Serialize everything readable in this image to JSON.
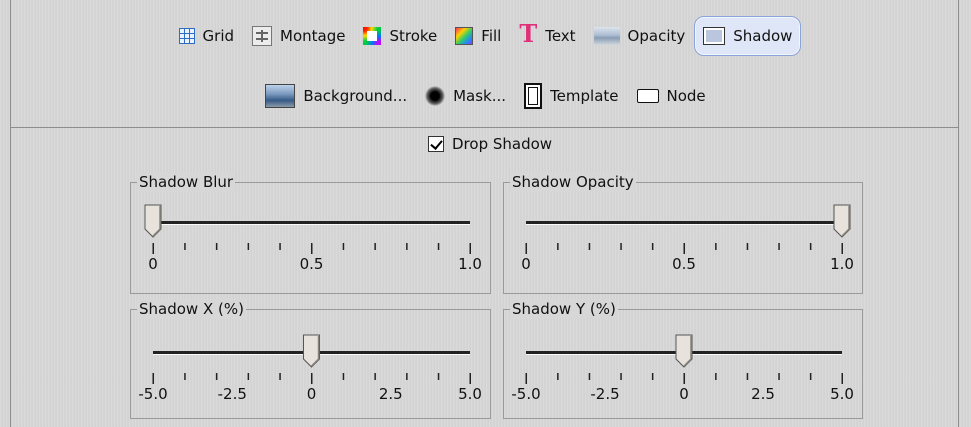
{
  "toolbar": {
    "row1": [
      {
        "label": "Grid",
        "icon": "grid-icon"
      },
      {
        "label": "Montage",
        "icon": "montage-icon"
      },
      {
        "label": "Stroke",
        "icon": "stroke-icon"
      },
      {
        "label": "Fill",
        "icon": "fill-icon"
      },
      {
        "label": "Text",
        "icon": "text-icon"
      },
      {
        "label": "Opacity",
        "icon": "opacity-icon"
      },
      {
        "label": "Shadow",
        "icon": "shadow-icon",
        "active": true
      }
    ],
    "row2": [
      {
        "label": "Background...",
        "icon": "background-icon"
      },
      {
        "label": "Mask...",
        "icon": "mask-icon"
      },
      {
        "label": "Template",
        "icon": "template-icon"
      },
      {
        "label": "Node",
        "icon": "node-icon"
      }
    ]
  },
  "drop_shadow": {
    "label": "Drop Shadow",
    "checked": true
  },
  "sliders": {
    "blur": {
      "title": "Shadow Blur",
      "min": 0,
      "max": 1.0,
      "value": 0,
      "labels": [
        "0",
        "0.5",
        "1.0"
      ],
      "ticks": 11
    },
    "opacity": {
      "title": "Shadow Opacity",
      "min": 0,
      "max": 1.0,
      "value": 1.0,
      "labels": [
        "0",
        "0.5",
        "1.0"
      ],
      "ticks": 11
    },
    "x": {
      "title": "Shadow X (%)",
      "min": -5.0,
      "max": 5.0,
      "value": 0,
      "labels": [
        "-5.0",
        "-2.5",
        "0",
        "2.5",
        "5.0"
      ],
      "ticks": 11
    },
    "y": {
      "title": "Shadow Y (%)",
      "min": -5.0,
      "max": 5.0,
      "value": 0,
      "labels": [
        "-5.0",
        "-2.5",
        "0",
        "2.5",
        "5.0"
      ],
      "ticks": 11
    }
  },
  "colors": {
    "active_bg": "#dfe6f7",
    "active_border": "#8aa3d8"
  }
}
